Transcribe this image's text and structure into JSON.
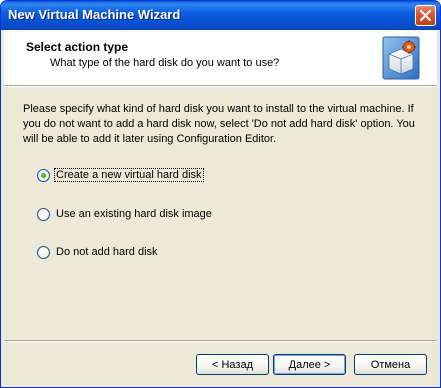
{
  "window": {
    "title": "New Virtual Machine Wizard"
  },
  "header": {
    "title": "Select action type",
    "subtitle": "What type of the hard disk do you want to use?",
    "icon": "wizard-gear-icon"
  },
  "body": {
    "description": "Please specify what kind of hard disk you want to install to the virtual machine. If you do not want to add a hard disk now, select 'Do not add hard disk' option. You will be able to add it later using Configuration Editor."
  },
  "options": [
    {
      "label": "Create a new virtual hard disk",
      "selected": true
    },
    {
      "label": "Use an existing hard disk image",
      "selected": false
    },
    {
      "label": "Do not add hard disk",
      "selected": false
    }
  ],
  "buttons": {
    "back": "< Назад",
    "next": "Далее >",
    "cancel": "Отмена"
  },
  "colors": {
    "title_bar": "#0552d2",
    "dialog_bg": "#ece9d8",
    "radio_selected": "#21a121"
  }
}
